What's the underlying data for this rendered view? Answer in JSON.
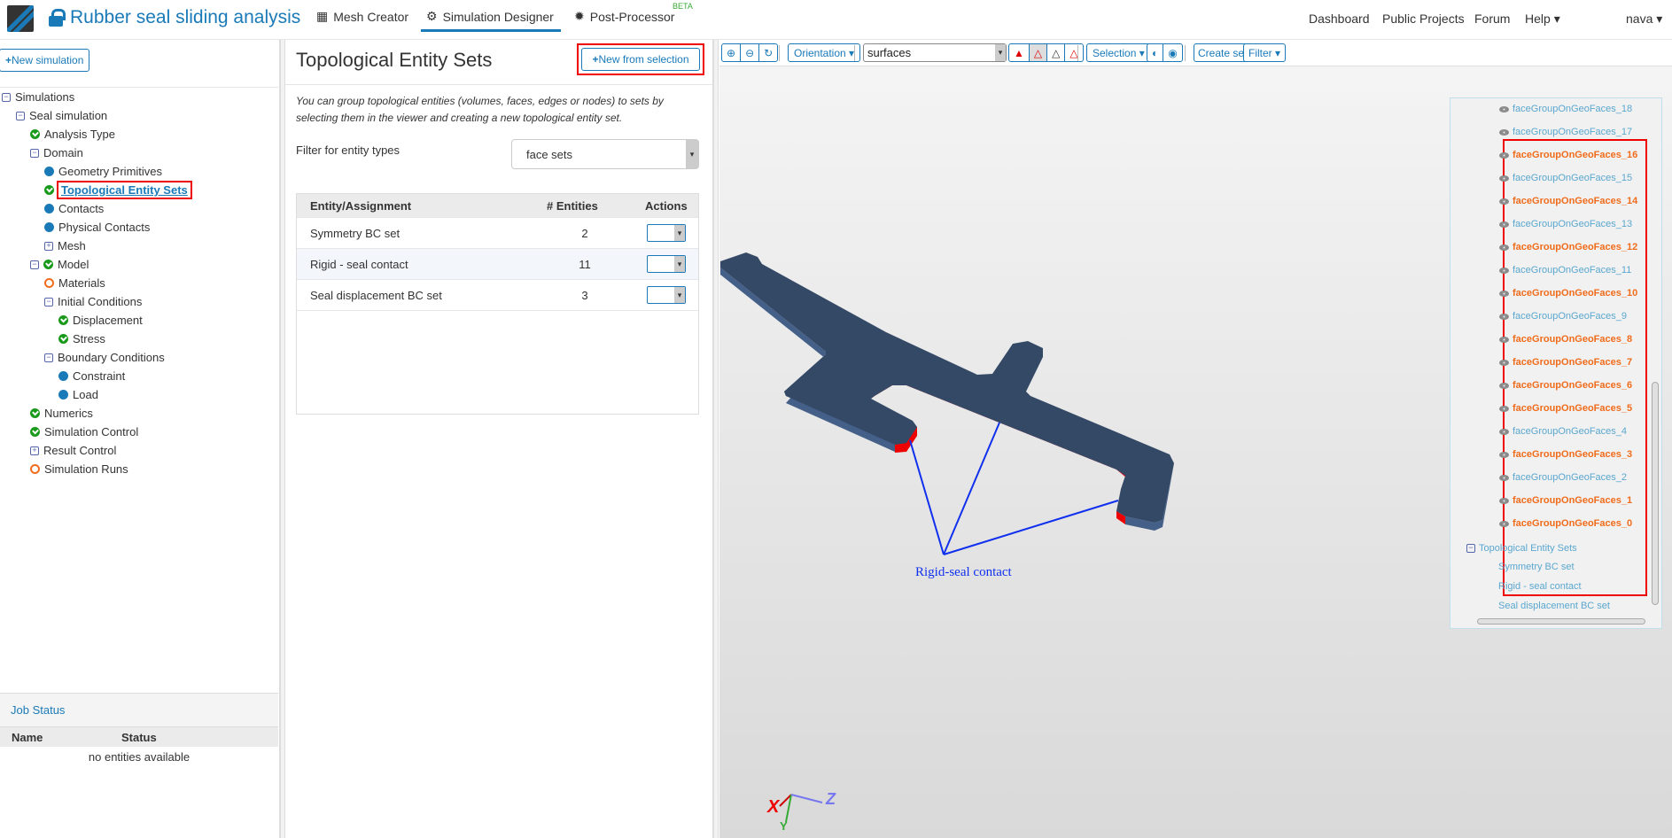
{
  "header": {
    "title": "Rubber seal sliding analysis",
    "nav": [
      {
        "label": "Mesh Creator",
        "icon": "grid-icon"
      },
      {
        "label": "Simulation Designer",
        "icon": "gears-icon",
        "active": true
      },
      {
        "label": "Post-Processor",
        "icon": "gear-icon",
        "badge": "BETA"
      }
    ],
    "right": [
      "Dashboard",
      "Public Projects",
      "Forum",
      "Help",
      "nava"
    ]
  },
  "left": {
    "new_simulation": "New simulation",
    "tree": [
      {
        "label": "Simulations",
        "level": 0,
        "icon": "minus"
      },
      {
        "label": "Seal simulation",
        "level": 1,
        "icon": "minus"
      },
      {
        "label": "Analysis Type",
        "level": 2,
        "icon": "ok"
      },
      {
        "label": "Domain",
        "level": 2,
        "icon": "minus"
      },
      {
        "label": "Geometry Primitives",
        "level": 3,
        "icon": "blue"
      },
      {
        "label": "Topological Entity Sets",
        "level": 3,
        "icon": "ok",
        "selected": true
      },
      {
        "label": "Contacts",
        "level": 3,
        "icon": "blue"
      },
      {
        "label": "Physical Contacts",
        "level": 3,
        "icon": "blue"
      },
      {
        "label": "Mesh",
        "level": 3,
        "icon": "plus"
      },
      {
        "label": "Model",
        "level": 2,
        "icon": "minus-ok"
      },
      {
        "label": "Materials",
        "level": 3,
        "icon": "ring"
      },
      {
        "label": "Initial Conditions",
        "level": 3,
        "icon": "minus"
      },
      {
        "label": "Displacement",
        "level": 4,
        "icon": "ok"
      },
      {
        "label": "Stress",
        "level": 4,
        "icon": "ok"
      },
      {
        "label": "Boundary Conditions",
        "level": 3,
        "icon": "minus"
      },
      {
        "label": "Constraint",
        "level": 4,
        "icon": "blue"
      },
      {
        "label": "Load",
        "level": 4,
        "icon": "blue"
      },
      {
        "label": "Numerics",
        "level": 2,
        "icon": "ok"
      },
      {
        "label": "Simulation Control",
        "level": 2,
        "icon": "ok"
      },
      {
        "label": "Result Control",
        "level": 2,
        "icon": "plus"
      },
      {
        "label": "Simulation Runs",
        "level": 2,
        "icon": "ring"
      }
    ],
    "job_status": {
      "title": "Job Status",
      "columns": [
        "Name",
        "Status"
      ],
      "empty": "no entities available"
    }
  },
  "middle": {
    "title": "Topological Entity Sets",
    "new_from_selection": "New from selection",
    "description": "You can group topological entities (volumes, faces, edges or nodes) to sets by selecting them in the viewer and creating a new topological entity set.",
    "filter_label": "Filter for entity types",
    "filter_value": "face sets",
    "columns": [
      "Entity/Assignment",
      "# Entities",
      "Actions"
    ],
    "rows": [
      {
        "name": "Symmetry BC set",
        "count": "2"
      },
      {
        "name": "Rigid - seal contact",
        "count": "11"
      },
      {
        "name": "Seal displacement BC set",
        "count": "3"
      }
    ]
  },
  "viewer": {
    "toolbar": {
      "orientation": "Orientation",
      "mode": "surfaces",
      "selection": "Selection",
      "create_set": "Create set",
      "filter": "Filter"
    },
    "faces": [
      {
        "label": "faceGroupOnGeoFaces_18",
        "hl": false
      },
      {
        "label": "faceGroupOnGeoFaces_17",
        "hl": false
      },
      {
        "label": "faceGroupOnGeoFaces_16",
        "hl": true
      },
      {
        "label": "faceGroupOnGeoFaces_15",
        "hl": false
      },
      {
        "label": "faceGroupOnGeoFaces_14",
        "hl": true
      },
      {
        "label": "faceGroupOnGeoFaces_13",
        "hl": false
      },
      {
        "label": "faceGroupOnGeoFaces_12",
        "hl": true
      },
      {
        "label": "faceGroupOnGeoFaces_11",
        "hl": false
      },
      {
        "label": "faceGroupOnGeoFaces_10",
        "hl": true
      },
      {
        "label": "faceGroupOnGeoFaces_9",
        "hl": false
      },
      {
        "label": "faceGroupOnGeoFaces_8",
        "hl": true
      },
      {
        "label": "faceGroupOnGeoFaces_7",
        "hl": true
      },
      {
        "label": "faceGroupOnGeoFaces_6",
        "hl": true
      },
      {
        "label": "faceGroupOnGeoFaces_5",
        "hl": true
      },
      {
        "label": "faceGroupOnGeoFaces_4",
        "hl": false
      },
      {
        "label": "faceGroupOnGeoFaces_3",
        "hl": true
      },
      {
        "label": "faceGroupOnGeoFaces_2",
        "hl": false
      },
      {
        "label": "faceGroupOnGeoFaces_1",
        "hl": true
      },
      {
        "label": "faceGroupOnGeoFaces_0",
        "hl": true
      }
    ],
    "sets_group": "Topological Entity Sets",
    "sets": [
      "Symmetry BC set",
      "Rigid - seal contact",
      "Seal displacement BC set"
    ],
    "annotation": "Rigid-seal contact",
    "axes": [
      "X",
      "Y",
      "Z"
    ]
  },
  "colors": {
    "accent": "#1a7ab8",
    "highlight": "#f06c1c",
    "body": "#344966",
    "selected_face": "#ee0000"
  }
}
